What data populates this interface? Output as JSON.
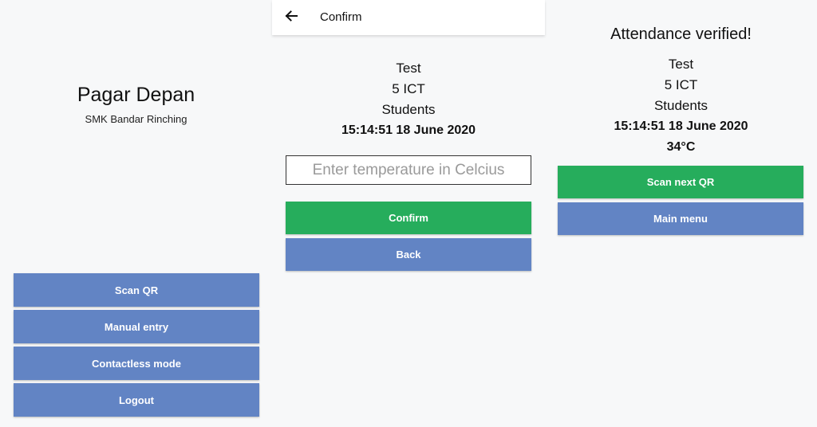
{
  "home": {
    "title": "Pagar Depan",
    "subtitle": "SMK Bandar Rinching",
    "buttons": {
      "scan_qr": "Scan QR",
      "manual_entry": "Manual entry",
      "contactless_mode": "Contactless mode",
      "logout": "Logout"
    }
  },
  "confirm": {
    "appbar_title": "Confirm",
    "name": "Test",
    "class": "5 ICT",
    "category": "Students",
    "datetime": "15:14:51 18 June 2020",
    "temperature_placeholder": "Enter temperature in Celcius",
    "temperature_value": "",
    "buttons": {
      "confirm": "Confirm",
      "back": "Back"
    }
  },
  "verified": {
    "title": "Attendance verified!",
    "name": "Test",
    "class": "5 ICT",
    "category": "Students",
    "datetime": "15:14:51 18 June 2020",
    "temperature": "34°C",
    "buttons": {
      "scan_next": "Scan next QR",
      "main_menu": "Main menu"
    }
  },
  "icons": {
    "back": "arrow-left"
  },
  "colors": {
    "primary_blue": "#6284c4",
    "success_green": "#26ad5c",
    "background": "#f7f8f9"
  }
}
